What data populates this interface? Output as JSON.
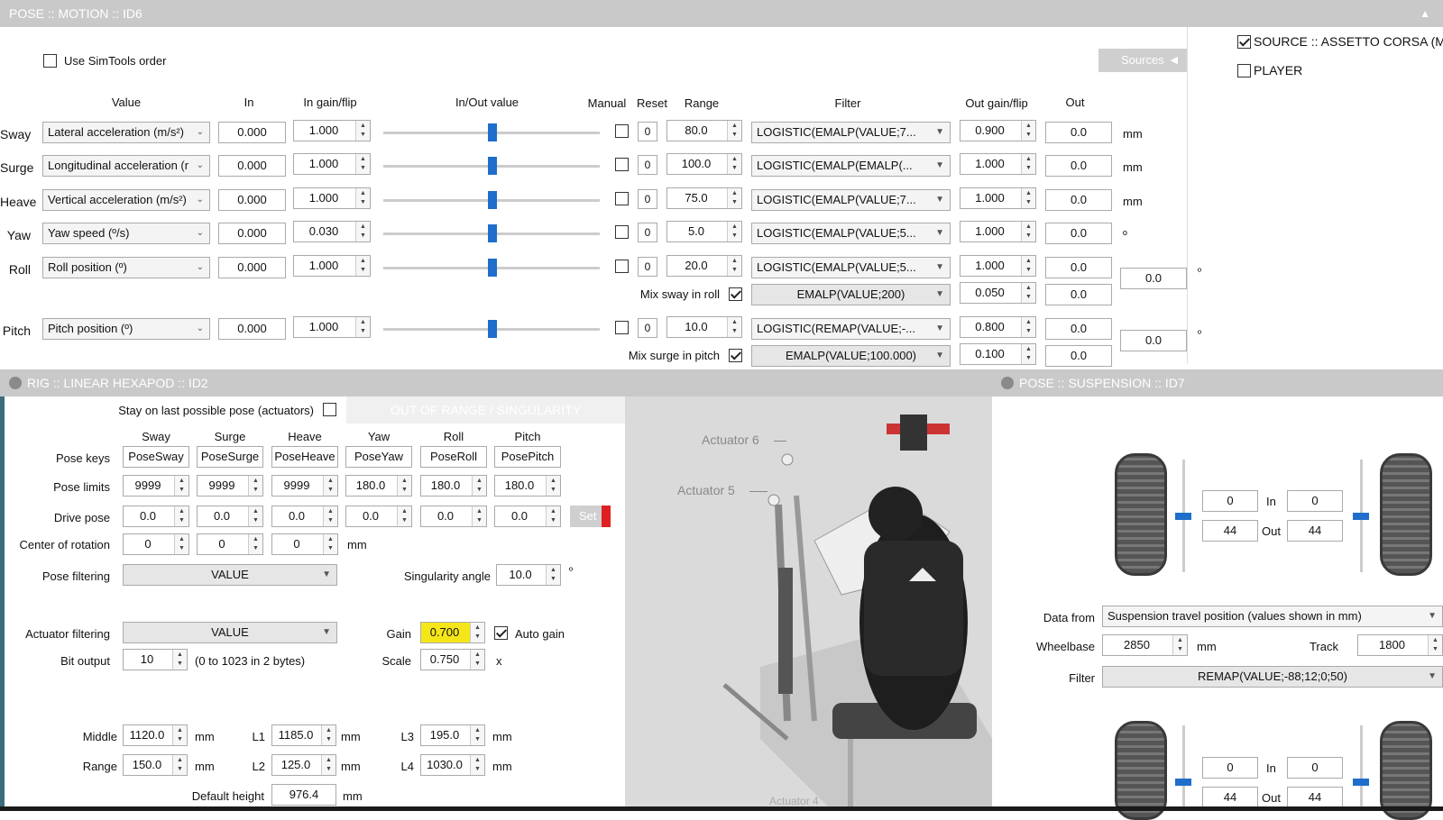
{
  "motion": {
    "title": "POSE :: MOTION :: ID6",
    "use_simtools": "Use SimTools order",
    "sources_button": "Sources",
    "source_assetto": "SOURCE :: ASSETTO CORSA (MM",
    "source_player": "PLAYER",
    "headers": {
      "value": "Value",
      "in": "In",
      "in_gain": "In gain/flip",
      "inout": "In/Out value",
      "manual": "Manual",
      "reset": "Reset",
      "range": "Range",
      "filter": "Filter",
      "out_gain": "Out gain/flip",
      "out": "Out"
    },
    "rows": [
      {
        "label": "Sway",
        "value": "Lateral acceleration (m/s²)",
        "in": "0.000",
        "in_gain": "1.000",
        "reset": "0",
        "range": "80.0",
        "filter": "LOGISTIC(EMALP(VALUE;7...",
        "out_gain": "0.900",
        "out": "0.0",
        "unit": "mm"
      },
      {
        "label": "Surge",
        "value": "Longitudinal acceleration (r",
        "in": "0.000",
        "in_gain": "1.000",
        "reset": "0",
        "range": "100.0",
        "filter": "LOGISTIC(EMALP(EMALP(...",
        "out_gain": "1.000",
        "out": "0.0",
        "unit": "mm"
      },
      {
        "label": "Heave",
        "value": "Vertical acceleration (m/s²)",
        "in": "0.000",
        "in_gain": "1.000",
        "reset": "0",
        "range": "75.0",
        "filter": "LOGISTIC(EMALP(VALUE;7...",
        "out_gain": "1.000",
        "out": "0.0",
        "unit": "mm"
      },
      {
        "label": "Yaw",
        "value": "Yaw speed (º/s)",
        "in": "0.000",
        "in_gain": "0.030",
        "reset": "0",
        "range": "5.0",
        "filter": "LOGISTIC(EMALP(VALUE;5...",
        "out_gain": "1.000",
        "out": "0.0",
        "unit": "º"
      },
      {
        "label": "Roll",
        "value": "Roll position (º)",
        "in": "0.000",
        "in_gain": "1.000",
        "reset": "0",
        "range": "20.0",
        "filter": "LOGISTIC(EMALP(VALUE;5...",
        "out_gain": "1.000",
        "out": "0.0",
        "unit": ""
      },
      {
        "label": "Pitch",
        "value": "Pitch position (º)",
        "in": "0.000",
        "in_gain": "1.000",
        "reset": "0",
        "range": "10.0",
        "filter": "LOGISTIC(REMAP(VALUE;-...",
        "out_gain": "0.800",
        "out": "0.0",
        "unit": ""
      }
    ],
    "mix_roll": {
      "label": "Mix sway in roll",
      "filter": "EMALP(VALUE;200)",
      "gain": "0.050",
      "out": "0.0",
      "total": "0.0",
      "unit": "º"
    },
    "mix_pitch": {
      "label": "Mix surge in pitch",
      "filter": "EMALP(VALUE;100.000)",
      "gain": "0.100",
      "out": "0.0",
      "total": "0.0",
      "unit": "º"
    }
  },
  "rig": {
    "title": "RIG :: LINEAR HEXAPOD :: ID2",
    "stay_label": "Stay on last possible pose (actuators)",
    "out_of_range": "OUT OF RANGE / SINGULARITY",
    "cols": [
      "Sway",
      "Surge",
      "Heave",
      "Yaw",
      "Roll",
      "Pitch"
    ],
    "pose_keys_label": "Pose keys",
    "pose_keys": [
      "PoseSway",
      "PoseSurge",
      "PoseHeave",
      "PoseYaw",
      "PoseRoll",
      "PosePitch"
    ],
    "pose_limits_label": "Pose limits",
    "pose_limits": [
      "9999",
      "9999",
      "9999",
      "180.0",
      "180.0",
      "180.0"
    ],
    "drive_pose_label": "Drive pose",
    "drive_pose": [
      "0.0",
      "0.0",
      "0.0",
      "0.0",
      "0.0",
      "0.0"
    ],
    "set_label": "Set",
    "cor_label": "Center of rotation",
    "cor": [
      "0",
      "0",
      "0"
    ],
    "mm": "mm",
    "pose_filtering_label": "Pose filtering",
    "pose_filtering": "VALUE",
    "singularity_label": "Singularity angle",
    "singularity": "10.0",
    "deg": "º",
    "actuator_filtering_label": "Actuator filtering",
    "actuator_filtering": "VALUE",
    "gain_label": "Gain",
    "gain": "0.700",
    "auto_gain": "Auto gain",
    "bit_output_label": "Bit output",
    "bit_output": "10",
    "bit_note": "(0 to 1023 in 2 bytes)",
    "scale_label": "Scale",
    "scale": "0.750",
    "x": "x",
    "middle_label": "Middle",
    "middle": "1120.0",
    "l1_label": "L1",
    "l1": "1185.0",
    "l3_label": "L3",
    "l3": "195.0",
    "range_label": "Range",
    "range": "150.0",
    "l2_label": "L2",
    "l2": "125.0",
    "l4_label": "L4",
    "l4": "1030.0",
    "default_height_label": "Default height",
    "default_height": "976.4",
    "actuator6": "Actuator 6",
    "actuator5": "Actuator 5",
    "actuator4": "Actuator 4"
  },
  "suspension": {
    "title": "POSE :: SUSPENSION :: ID7",
    "front": {
      "in_left": "0",
      "in_right": "0",
      "out_left": "44",
      "out_right": "44"
    },
    "rear": {
      "in_left": "0",
      "in_right": "0",
      "out_left": "44",
      "out_right": "44"
    },
    "in_label": "In",
    "out_label": "Out",
    "data_from_label": "Data from",
    "data_from": "Suspension travel position (values shown in mm)",
    "wheelbase_label": "Wheelbase",
    "wheelbase": "2850",
    "mm": "mm",
    "track_label": "Track",
    "track": "1800",
    "filter_label": "Filter",
    "filter": "REMAP(VALUE;-88;12;0;50)"
  }
}
